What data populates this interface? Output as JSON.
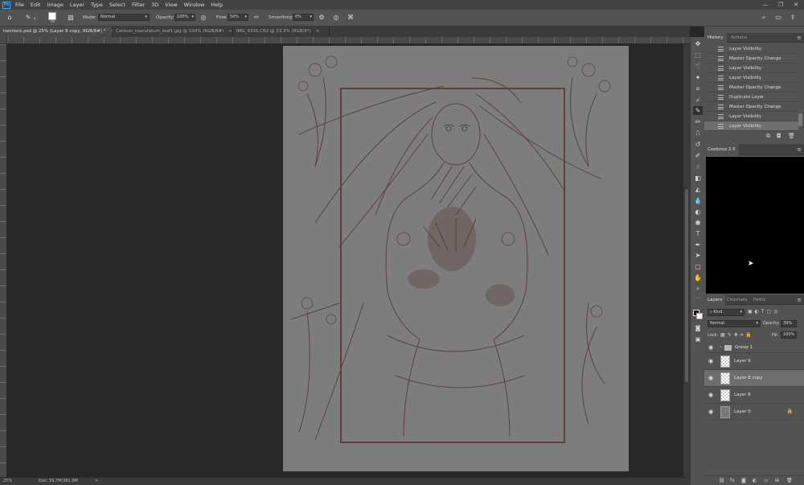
{
  "app": {
    "logo_text": "Ps",
    "menu": [
      "File",
      "Edit",
      "Image",
      "Layer",
      "Type",
      "Select",
      "Filter",
      "3D",
      "View",
      "Window",
      "Help"
    ],
    "window_controls": {
      "minimize": "—",
      "restore": "❐",
      "close": "✕"
    }
  },
  "options_bar": {
    "brush_size": "70",
    "mode_label": "Mode:",
    "mode_value": "Normal",
    "opacity_label": "Opacity:",
    "opacity_value": "100%",
    "flow_label": "Flow:",
    "flow_value": "50%",
    "smoothing_label": "Smoothing:",
    "smoothing_value": "0%"
  },
  "tabs": [
    {
      "label": "hemlock.psd @ 25% (Layer 8 copy, RGB/8#) *",
      "active": true
    },
    {
      "label": "Conium_maculatum_leaf1.jpg @ 100% (RGB/8#)",
      "active": false
    },
    {
      "label": "IMG_9316.CR2 @ 33.3% (RGB/8*)",
      "active": false
    }
  ],
  "status": {
    "zoom": "25%",
    "doc": "Doc: 39.7M/381.9M",
    "arrow": ">"
  },
  "history": {
    "tabs": [
      "History",
      "Actions"
    ],
    "items": [
      "Layer Visibility",
      "Master Opacity Change",
      "Layer Visibility",
      "Layer Visibility",
      "Master Opacity Change",
      "Duplicate Layer",
      "Master Opacity Change",
      "Layer Visibility",
      "Layer Visibility"
    ]
  },
  "colorus": {
    "title": "Coolorus 2.5"
  },
  "layers": {
    "tabs": [
      "Layers",
      "Channels",
      "Paths"
    ],
    "kind_label": "Kind",
    "blend_mode": "Normal",
    "opacity_label": "Opacity:",
    "opacity_value": "39%",
    "lock_label": "Lock:",
    "fill_label": "Fill:",
    "fill_value": "100%",
    "items": [
      {
        "name": "Group 1",
        "type": "group"
      },
      {
        "name": "Layer 9",
        "type": "layer"
      },
      {
        "name": "Layer 8 copy",
        "type": "layer",
        "selected": true
      },
      {
        "name": "Layer 8",
        "type": "layer"
      },
      {
        "name": "Layer 0",
        "type": "layer",
        "locked": true
      }
    ]
  },
  "colors": {
    "foreground": "#2a1410",
    "background": "#ffffff",
    "sketch_line": "#5a3a36",
    "canvas_gray": "#7d7d7d",
    "accent_blue": "#31a8ff"
  }
}
